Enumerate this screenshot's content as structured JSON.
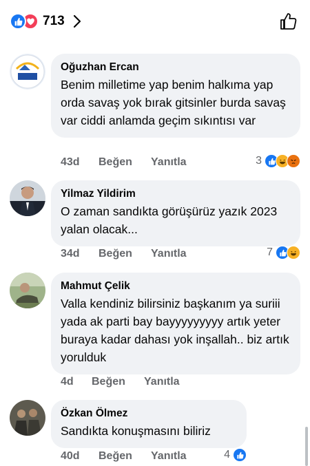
{
  "reactions_bar": {
    "count": "713",
    "icons": [
      "like-icon",
      "love-icon"
    ]
  },
  "comments": [
    {
      "author": "Oğuzhan Ercan",
      "text": "Benim milletime yap benim halkıma yap orda savaş yok bırak gitsinler burda savaş var ciddi anlamda geçim sıkıntısı var",
      "time": "43d",
      "like_label": "Beğen",
      "reply_label": "Yanıtla",
      "reaction_count": "3",
      "reactions": [
        "like-icon",
        "haha-icon",
        "angry-icon"
      ],
      "avatar_logo_text": "ERCAN EĞİTİM KURUMLARI"
    },
    {
      "author": "Yilmaz Yildirim",
      "text": "O zaman sandıkta görüşürüz yazık 2023 yalan olacak...",
      "time": "34d",
      "like_label": "Beğen",
      "reply_label": "Yanıtla",
      "reaction_count": "7",
      "reactions": [
        "like-icon",
        "haha-icon"
      ]
    },
    {
      "author": "Mahmut Çelik",
      "text": "Valla kendiniz bilirsiniz başkanım ya suriii yada ak parti bay bayyyyyyyyy artık yeter buraya kadar dahası yok inşallah.. biz artık yorulduk",
      "time": "4d",
      "like_label": "Beğen",
      "reply_label": "Yanıtla",
      "reaction_count": "",
      "reactions": []
    },
    {
      "author": "Özkan Ölmez",
      "text": "Sandıkta konuşmasını biliriz",
      "time": "40d",
      "like_label": "Beğen",
      "reply_label": "Yanıtla",
      "reaction_count": "4",
      "reactions": [
        "like-icon"
      ]
    }
  ],
  "colors": {
    "like_blue": "#1877f2",
    "love_red": "#f33e58",
    "haha_yellow": "#f7b125",
    "angry_orange": "#e9710f",
    "bubble_bg": "#f0f2f5",
    "meta_gray": "#65676b"
  }
}
